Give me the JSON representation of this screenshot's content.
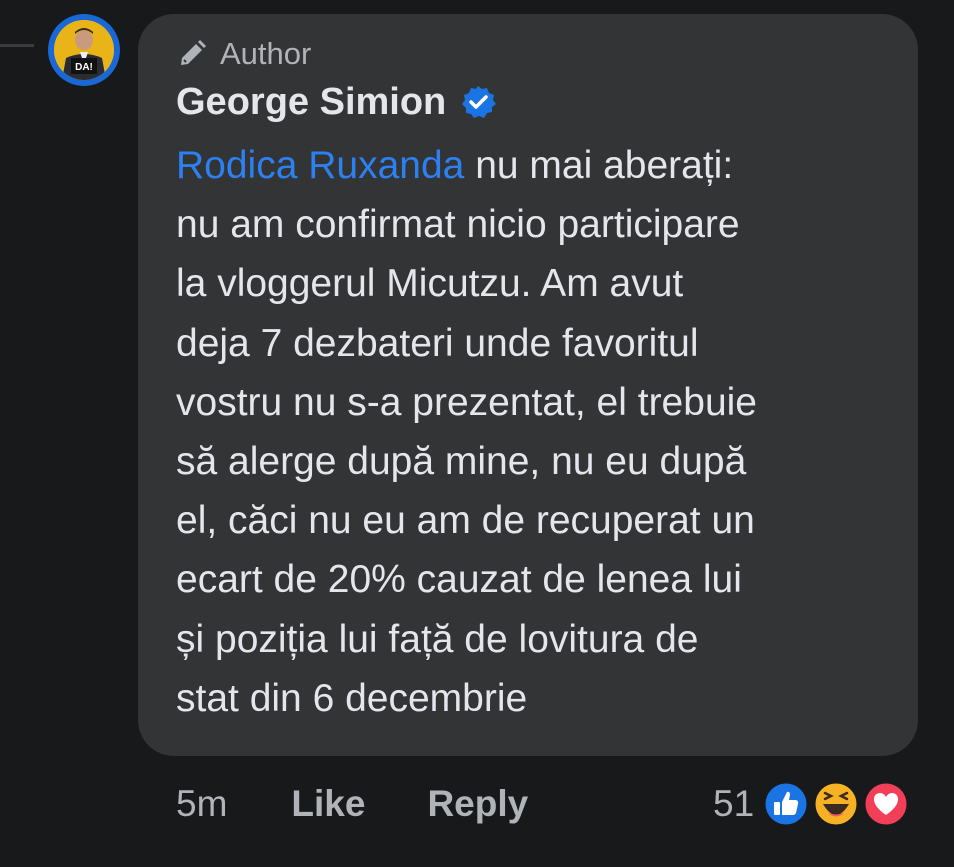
{
  "comment": {
    "badge_label": "Author",
    "author_name": "George Simion",
    "avatar_text": "DA!",
    "mention": "Rodica Ruxanda",
    "lines": [
      " nu mai aberați:",
      "nu am confirmat nicio participare",
      "la vloggerul Micutzu. Am avut",
      "deja 7 dezbateri unde favoritul",
      "vostru nu s-a prezentat, el trebuie",
      "să alerge după mine, nu eu după",
      "el, căci nu eu am de recuperat un",
      "ecart de 20% cauzat de lenea lui",
      "și poziția lui față de lovitura de",
      "stat din 6 decembrie"
    ]
  },
  "actions": {
    "time": "5m",
    "like_label": "Like",
    "reply_label": "Reply"
  },
  "reactions": {
    "count": "51",
    "icons": [
      "like-reaction-icon",
      "haha-reaction-icon",
      "love-reaction-icon"
    ]
  },
  "colors": {
    "background": "#18191b",
    "bubble": "#333436",
    "mention": "#2d80f0",
    "verified": "#1b74e4"
  }
}
